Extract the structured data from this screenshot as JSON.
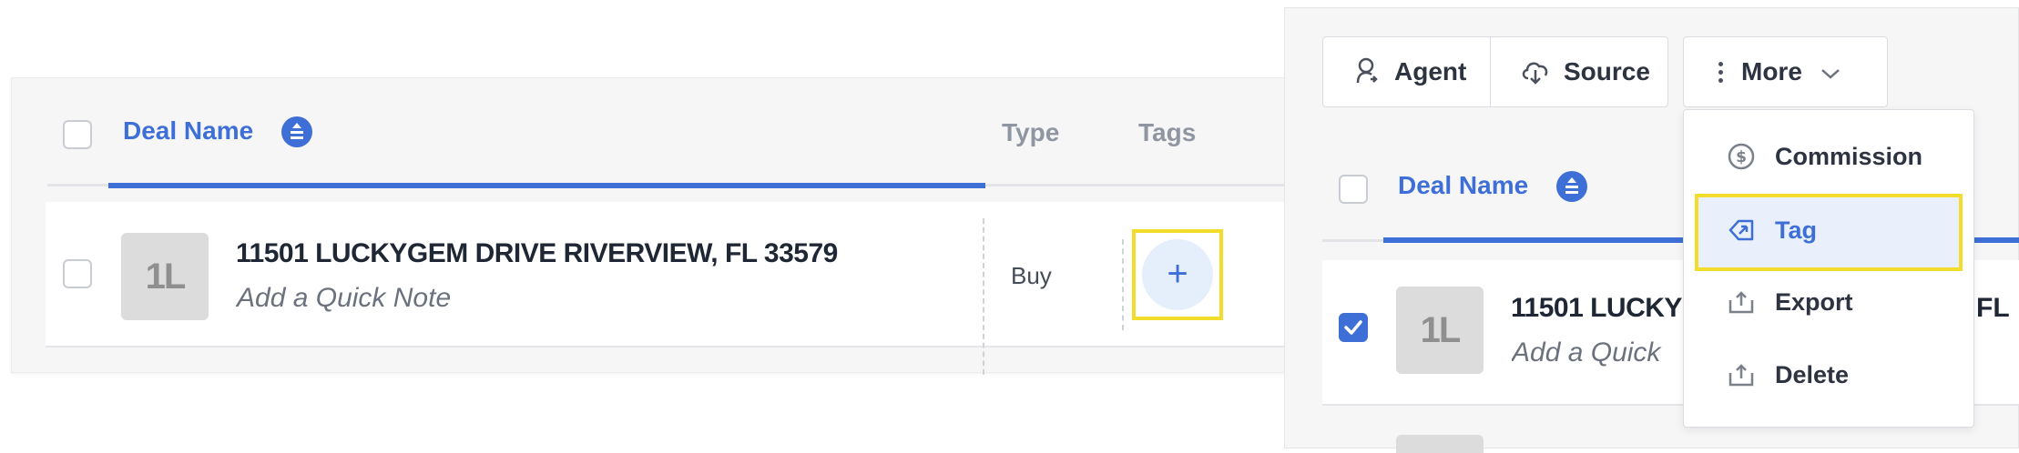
{
  "left": {
    "header": {
      "deal_name": "Deal Name",
      "type": "Type",
      "tags": "Tags"
    },
    "row": {
      "avatar_initials": "1L",
      "address": "11501 LUCKYGEM DRIVE RIVERVIEW, FL 33579",
      "note_placeholder": "Add a Quick Note",
      "type": "Buy",
      "add_tag_symbol": "+"
    }
  },
  "right": {
    "toolbar": {
      "agent_label": "Agent",
      "source_label": "Source",
      "more_label": "More"
    },
    "header": {
      "deal_name": "Deal Name"
    },
    "row": {
      "selected": true,
      "avatar_initials": "1L",
      "address_visible": "11501 LUCKYG",
      "address_tail": "FL",
      "note_visible": "Add a Quick"
    },
    "more_menu": {
      "items": [
        {
          "label": "Commission",
          "icon": "dollar-circle-icon"
        },
        {
          "label": "Tag",
          "icon": "tag-icon",
          "active": true
        },
        {
          "label": "Export",
          "icon": "upload-tray-icon"
        },
        {
          "label": "Delete",
          "icon": "upload-tray-icon"
        }
      ]
    }
  },
  "colors": {
    "accent": "#3e6fd7",
    "highlight": "#f2dc2c",
    "tag_active_bg": "#e9f0fb",
    "add_button_bg": "#e5effb"
  }
}
